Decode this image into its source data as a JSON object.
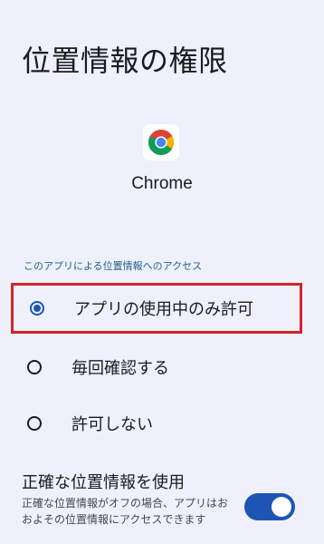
{
  "page": {
    "title": "位置情報の権限"
  },
  "app": {
    "name": "Chrome",
    "icon": "chrome-logo"
  },
  "section": {
    "label": "このアプリによる位置情報へのアクセス"
  },
  "options": [
    {
      "label": "アプリの使用中のみ許可",
      "selected": true,
      "highlighted": true
    },
    {
      "label": "毎回確認する",
      "selected": false
    },
    {
      "label": "許可しない",
      "selected": false
    }
  ],
  "precise": {
    "title": "正確な位置情報を使用",
    "description": "正確な位置情報がオフの場合、アプリはおおよその位置情報にアクセスできます",
    "enabled": true
  },
  "colors": {
    "background": "#eef1fb",
    "accent": "#1e55b4",
    "highlight_border": "#d4232a",
    "section_label": "#25608f"
  }
}
